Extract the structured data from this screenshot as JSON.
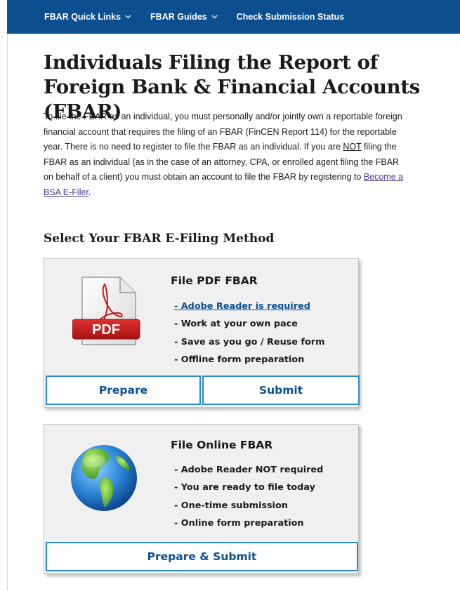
{
  "nav": {
    "items": [
      {
        "label": "FBAR Quick Links",
        "has_dropdown": true
      },
      {
        "label": "FBAR Guides",
        "has_dropdown": true
      },
      {
        "label": "Check Submission Status",
        "has_dropdown": false
      }
    ]
  },
  "page": {
    "title": "Individuals Filing the Report of Foreign Bank & Financial Accounts (FBAR)",
    "intro": {
      "part1": "To file the FBAR as an individual, you must personally and/or jointly own a reportable foreign financial account that requires the filing of an FBAR (FinCEN Report 114) for the reportable year. There is no need to register to file the FBAR as an individual. If you are ",
      "not": "NOT",
      "part2": " filing the FBAR as an individual (as in the case of an attorney, CPA, or enrolled agent filing the FBAR on behalf of a client) you must obtain an account to file the FBAR by registering to ",
      "link": "Become a BSA E-Filer",
      "part3": "."
    },
    "section_title": "Select Your FBAR E-Filing Method"
  },
  "pdf_card": {
    "icon": "pdf-file-icon",
    "icon_label": "PDF",
    "title": "File PDF FBAR",
    "features": [
      "- Adobe Reader is required",
      "- Work at your own pace",
      "- Save as you go / Reuse form",
      "- Offline form preparation"
    ],
    "prepare_label": "Prepare",
    "submit_label": "Submit"
  },
  "online_card": {
    "icon": "globe-icon",
    "title": "File Online FBAR",
    "features": [
      "- Adobe Reader NOT required",
      "- You are ready to file today",
      "- One-time submission",
      "- Online form preparation"
    ],
    "button_label": "Prepare & Submit"
  },
  "colors": {
    "nav_bg": "#0b4f8f",
    "link_blue": "#0b4f8f",
    "button_border": "#2a8ccd",
    "visited_link": "#4f3a9a",
    "card_bg": "#f0f0f0",
    "pdf_red": "#cc1f1f"
  }
}
